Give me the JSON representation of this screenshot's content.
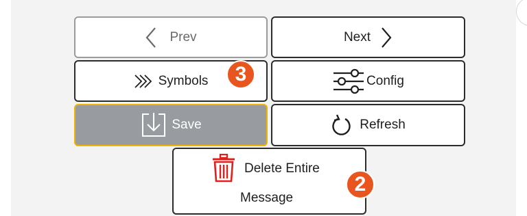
{
  "buttons": {
    "prev": {
      "label": "Prev",
      "icon": "chevron-left-icon"
    },
    "next": {
      "label": "Next",
      "icon": "chevron-right-icon"
    },
    "symbols": {
      "label": "Symbols",
      "icon": "triple-chevron-right-icon"
    },
    "config": {
      "label": "Config",
      "icon": "sliders-icon"
    },
    "save": {
      "label": "Save",
      "icon": "download-arrow-icon"
    },
    "refresh": {
      "label": "Refresh",
      "icon": "refresh-icon"
    },
    "delete": {
      "line1": "Delete Entire",
      "line2": "Message",
      "icon": "trash-icon"
    }
  },
  "badges": {
    "symbols": "3",
    "delete": "2"
  },
  "colors": {
    "badge": "#e8551f",
    "save_background": "#989ca1",
    "save_border": "#f2b400",
    "delete_icon": "#e0201c",
    "disabled_border": "#9a9a9a"
  }
}
